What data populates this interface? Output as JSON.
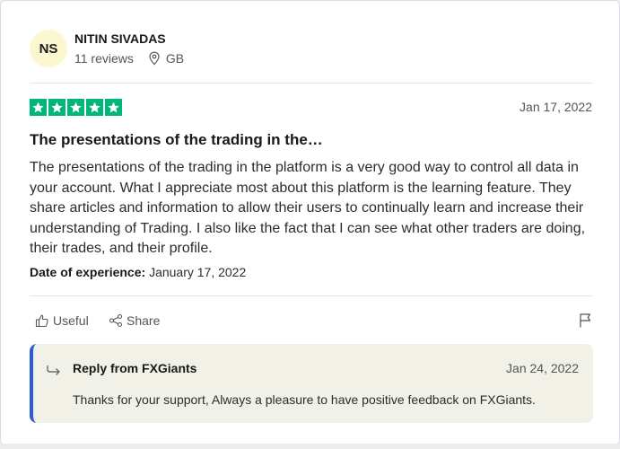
{
  "consumer": {
    "initials": "NS",
    "name": "NITIN SIVADAS",
    "reviews": "11 reviews",
    "country": "GB",
    "avatar_color": "#fbf7cf"
  },
  "review": {
    "rating": 5,
    "star_color": "#00b67a",
    "date": "Jan 17, 2022",
    "title": "The presentations of the trading in the…",
    "body": "The presentations of the trading in the platform is a very good way to control all data in your account. What I appreciate most about this platform is the learning feature. They share articles and information to allow their users to continually learn and increase their understanding of Trading. I also like the fact that I can see what other traders are doing, their trades, and their profile.",
    "experience_label": "Date of experience:",
    "experience_date": "January 17, 2022"
  },
  "actions": {
    "useful_label": "Useful",
    "share_label": "Share",
    "flag_icon": "flag-icon"
  },
  "reply": {
    "title": "Reply from FXGiants",
    "date": "Jan 24, 2022",
    "text": "Thanks for your support, Always a pleasure to have positive feedback on FXGiants.",
    "accent_color": "#2c5bdc"
  }
}
